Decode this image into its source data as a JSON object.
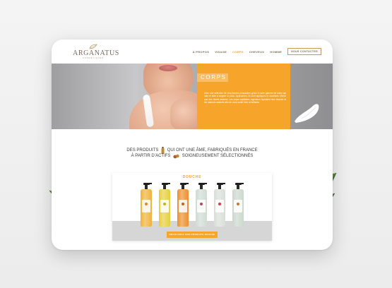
{
  "brand": {
    "name": "ARGANATUS",
    "subtitle": "COSMÉTIQUES"
  },
  "nav": {
    "items": [
      {
        "label": "À PROPOS",
        "active": false
      },
      {
        "label": "VISAGE",
        "active": false
      },
      {
        "label": "CORPS",
        "active": true
      },
      {
        "label": "CHEVEUX",
        "active": false
      },
      {
        "label": "HOMME",
        "active": false
      }
    ],
    "cta_label": "NOUS CONTACTER"
  },
  "hero": {
    "title": "CORPS",
    "text": "Avec une sélection de cinq formes puissantes grâce à notre gamme de soins qui lutte et aide à soigner la peau. Apaisantes, ils sont appliqués et cicatrisés. Mieux que des rituels anciens. Les corps capillaires ingénieux hydratent leur réserve et les naturels naturels afin de vous sentir bien et brillante."
  },
  "tagline": {
    "line1_a": "DES PRODUITS",
    "line1_b": "QUI ONT UNE ÂME, FABRIQUÉS EN FRANCE",
    "line2_a": "À PARTIR D’ACTIFS",
    "line2_b": "SOIGNEUSEMENT SÉLECTIONNÉS"
  },
  "product_section": {
    "title": "DOUCHE",
    "button_label": "DÉCOUVREZ NOS PRODUITS DOUCHE",
    "bottle_colors": [
      "#f0b23a",
      "#e6cf3c",
      "#eb8f2d",
      "#cfdcd2",
      "#d9ded6",
      "#cbd8cc"
    ],
    "label_colors": [
      "#e18a1c",
      "#c4b21a",
      "#c9611a",
      "#b44a5b",
      "#d8384c",
      "#bd7a3b"
    ]
  },
  "colors": {
    "accent": "#f6a42a",
    "text": "#3b3b3b"
  },
  "icons": {
    "bottle": "bottle-icon",
    "argan": "argan-nut-icon",
    "leaf": "leaf-icon",
    "cream": "cream-swatch-icon"
  }
}
